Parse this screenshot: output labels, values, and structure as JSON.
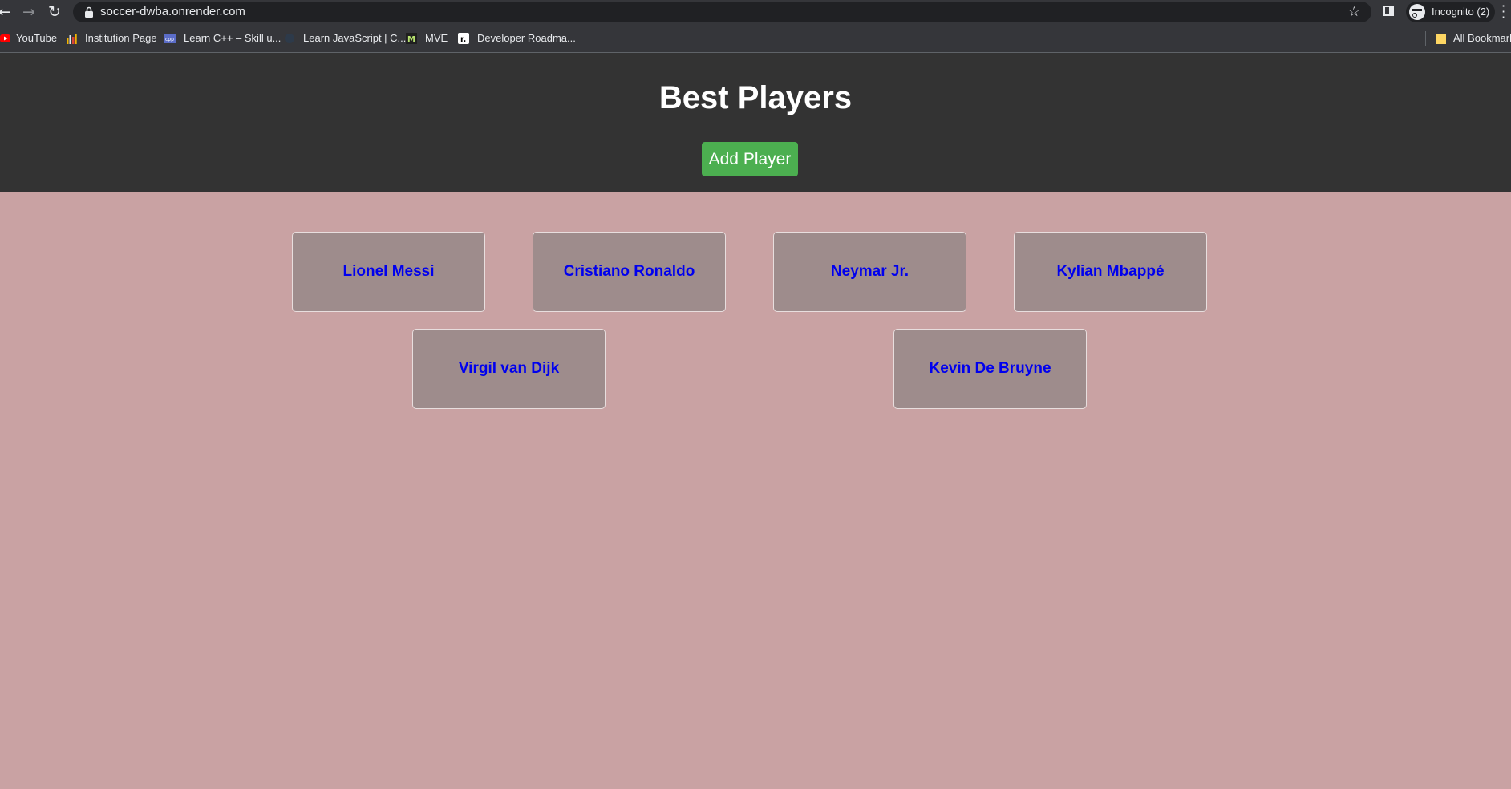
{
  "browser": {
    "url": "soccer-dwba.onrender.com",
    "incognito_label": "Incognito (2)",
    "bookmarks": [
      {
        "label": "YouTube",
        "icon": "youtube-icon"
      },
      {
        "label": "Institution Page",
        "icon": "bar-chart-icon"
      },
      {
        "label": "Learn C++ – Skill u...",
        "icon": "cpp-icon"
      },
      {
        "label": "Learn JavaScript | C...",
        "icon": "js-icon"
      },
      {
        "label": "MVE",
        "icon": "mve-icon"
      },
      {
        "label": "Developer Roadma...",
        "icon": "roadmap-icon"
      }
    ],
    "all_bookmarks_label": "All Bookmarks"
  },
  "header": {
    "title": "Best Players",
    "add_button_label": "Add Player"
  },
  "players": [
    {
      "name": "Lionel Messi"
    },
    {
      "name": "Cristiano Ronaldo"
    },
    {
      "name": "Neymar Jr."
    },
    {
      "name": "Kylian Mbappé"
    },
    {
      "name": "Virgil van Dijk"
    },
    {
      "name": "Kevin De Bruyne"
    }
  ],
  "colors": {
    "page_background": "#c9a2a3",
    "header_background": "#333333",
    "add_button": "#4caf50",
    "card_background": "#9e8c8c",
    "link": "#0000ee"
  }
}
